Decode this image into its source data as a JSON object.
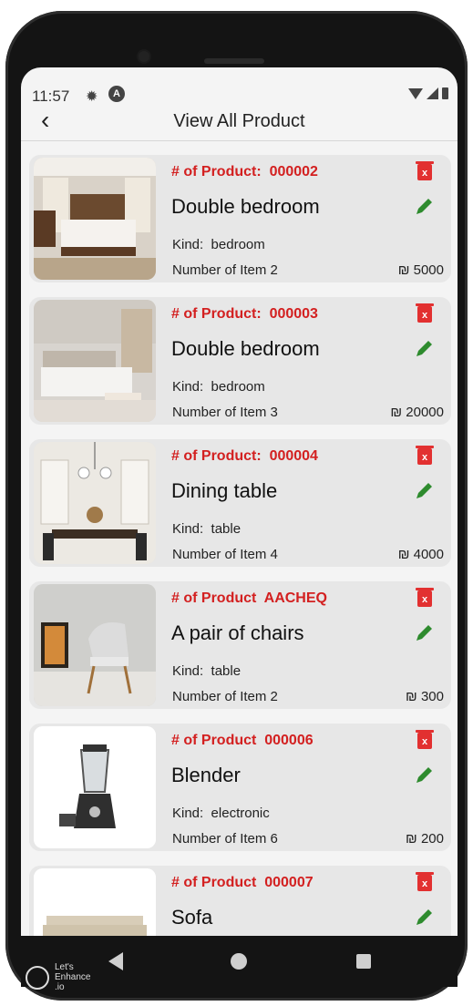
{
  "status_bar": {
    "time": "11:57"
  },
  "app_bar": {
    "back_icon": "chevron-left-icon",
    "title": "View All Product"
  },
  "products": [
    {
      "id_label": "# of Product:",
      "id": "000002",
      "name": "Double bedroom",
      "kind_label": "Kind:",
      "kind": "bedroom",
      "count_label": "Number of Item",
      "count": "2",
      "currency": "₪",
      "price": "5000"
    },
    {
      "id_label": "# of Product:",
      "id": "000003",
      "name": "Double bedroom",
      "kind_label": "Kind:",
      "kind": "bedroom",
      "count_label": "Number of Item",
      "count": "3",
      "currency": "₪",
      "price": "20000"
    },
    {
      "id_label": "# of Product:",
      "id": "000004",
      "name": "Dining table",
      "kind_label": "Kind:",
      "kind": "table",
      "count_label": "Number of Item",
      "count": "4",
      "currency": "₪",
      "price": "4000"
    },
    {
      "id_label": "# of Product",
      "id": "AACHEQ",
      "name": "A pair of chairs",
      "kind_label": "Kind:",
      "kind": "table",
      "count_label": "Number of Item",
      "count": "2",
      "currency": "₪",
      "price": "300"
    },
    {
      "id_label": "# of Product",
      "id": "000006",
      "name": "Blender",
      "kind_label": "Kind:",
      "kind": "electronic",
      "count_label": "Number of Item",
      "count": "6",
      "currency": "₪",
      "price": "200"
    },
    {
      "id_label": "# of Product",
      "id": "000007",
      "name": "Sofa",
      "kind_label": "",
      "kind": "",
      "count_label": "",
      "count": "",
      "currency": "",
      "price": ""
    }
  ],
  "watermark": {
    "line1": "Let's",
    "line2": "Enhance",
    "line3": ".io"
  },
  "colors": {
    "accent_red": "#d32020",
    "edit_green": "#2e8b2e",
    "card_bg": "#e7e7e7"
  }
}
